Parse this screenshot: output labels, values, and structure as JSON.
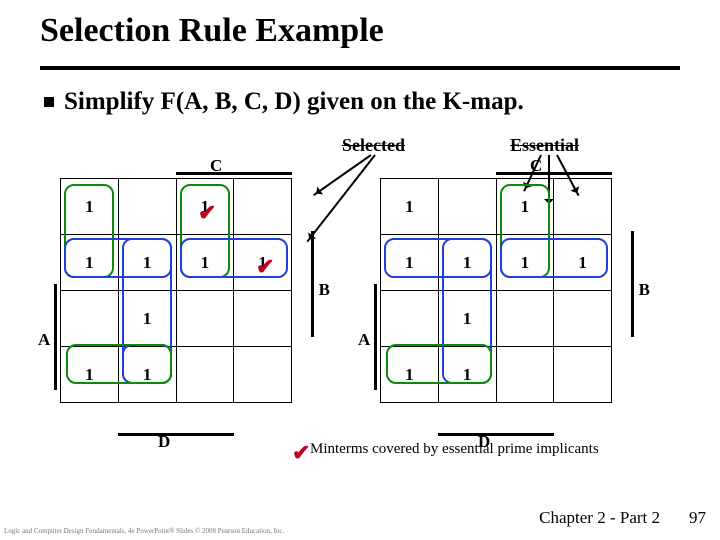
{
  "title": "Selection Rule Example",
  "bullet": "Simplify F(A, B, C, D) given on the K-map.",
  "labels": {
    "selected": "Selected",
    "essential": "Essential",
    "C": "C",
    "A": "A",
    "B": "B",
    "D": "D"
  },
  "kmap_cells": {
    "r0": [
      "1",
      "",
      "1",
      ""
    ],
    "r1": [
      "1",
      "1",
      "1",
      "1"
    ],
    "r2": [
      "",
      "1",
      "",
      ""
    ],
    "r3": [
      "1",
      "1",
      "",
      ""
    ]
  },
  "caption": "Minterms covered by essential prime implicants",
  "chapter": "Chapter 2 - Part 2",
  "page": "97",
  "copyright": "Logic and Computer Design Fundamentals, 4e\nPowerPoint® Slides\n© 2008 Pearson Education, Inc."
}
